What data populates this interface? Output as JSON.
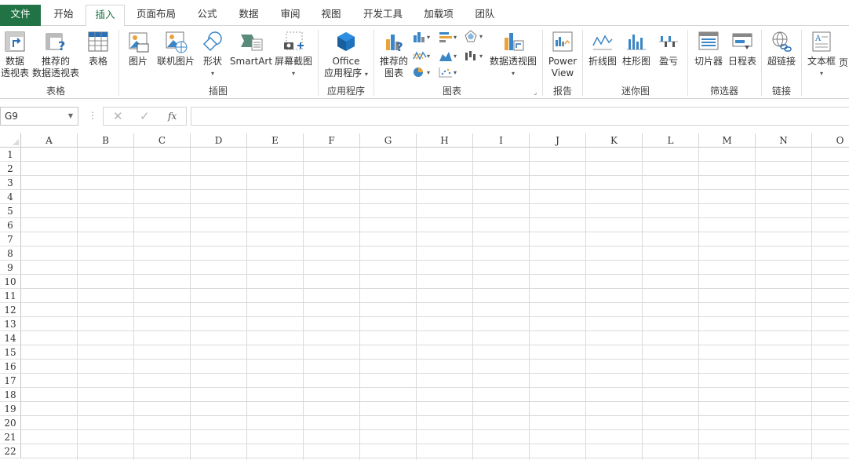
{
  "tabs": [
    "文件",
    "开始",
    "插入",
    "页面布局",
    "公式",
    "数据",
    "审阅",
    "视图",
    "开发工具",
    "加载项",
    "团队"
  ],
  "ribbon": {
    "groups": {
      "tables": "表格",
      "illustrations": "插图",
      "apps": "应用程序",
      "charts": "图表",
      "reports": "报告",
      "sparklines": "迷你图",
      "filters": "筛选器",
      "links": "链接"
    },
    "buttons": {
      "pivot_l1": "数据",
      "pivot_l2": "透视表",
      "rec_pivot_l1": "推荐的",
      "rec_pivot_l2": "数据透视表",
      "table": "表格",
      "picture": "图片",
      "online_picture": "联机图片",
      "shapes": "形状",
      "smartart": "SmartArt",
      "screenshot": "屏幕截图",
      "office_l1": "Office",
      "office_l2": "应用程序",
      "rec_charts_l1": "推荐的",
      "rec_charts_l2": "图表",
      "pivot_chart": "数据透视图",
      "power_l1": "Power",
      "power_l2": "View",
      "line": "折线图",
      "column": "柱形图",
      "winloss": "盈亏",
      "slicer": "切片器",
      "timeline": "日程表",
      "hyperlink": "超链接",
      "textbox": "文本框",
      "header_partial": "页"
    }
  },
  "formula_bar": {
    "name_box": "G9",
    "formula": "",
    "fx": "fx"
  },
  "columns": [
    "A",
    "B",
    "C",
    "D",
    "E",
    "F",
    "G",
    "H",
    "I",
    "J",
    "K",
    "L",
    "M",
    "N",
    "O"
  ],
  "rows": [
    "1",
    "2",
    "3",
    "4",
    "5",
    "6",
    "7",
    "8",
    "9",
    "10",
    "11",
    "12",
    "13",
    "14",
    "15",
    "16",
    "17",
    "18",
    "19",
    "20",
    "21",
    "22"
  ],
  "colors": {
    "file_tab": "#217346",
    "accent": "#217346"
  }
}
